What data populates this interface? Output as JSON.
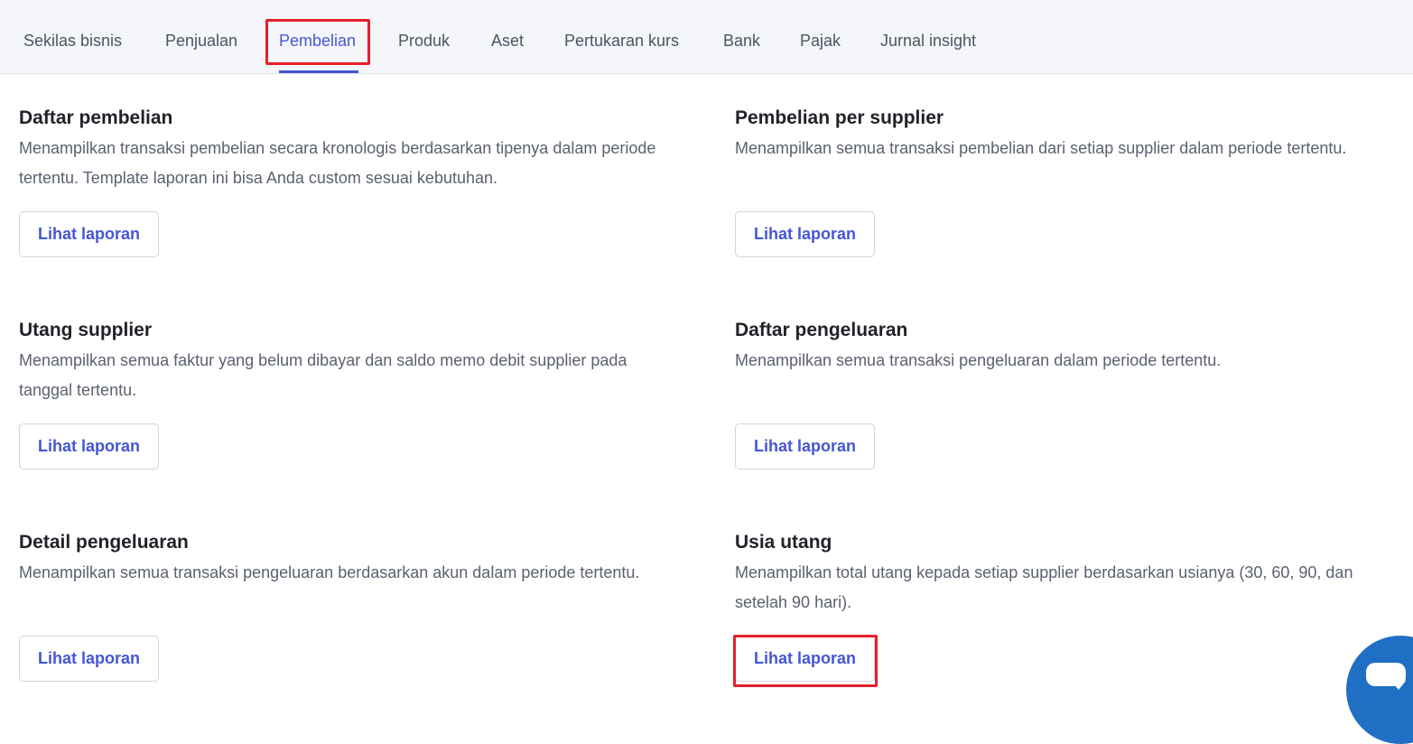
{
  "tabs": [
    {
      "label": "Sekilas bisnis",
      "active": false
    },
    {
      "label": "Penjualan",
      "active": false
    },
    {
      "label": "Pembelian",
      "active": true
    },
    {
      "label": "Produk",
      "active": false
    },
    {
      "label": "Aset",
      "active": false
    },
    {
      "label": "Pertukaran kurs",
      "active": false
    },
    {
      "label": "Bank",
      "active": false
    },
    {
      "label": "Pajak",
      "active": false
    },
    {
      "label": "Jurnal insight",
      "active": false
    }
  ],
  "reports": [
    {
      "title": "Daftar pembelian",
      "description": "Menampilkan transaksi pembelian secara kronologis berdasarkan tipenya dalam periode tertentu. Template laporan ini bisa Anda custom sesuai kebutuhan.",
      "button": "Lihat laporan"
    },
    {
      "title": "Pembelian per supplier",
      "description": "Menampilkan semua transaksi pembelian dari setiap supplier dalam periode tertentu.",
      "button": "Lihat laporan"
    },
    {
      "title": "Utang supplier",
      "description": "Menampilkan semua faktur yang belum dibayar dan saldo memo debit supplier pada tanggal tertentu.",
      "button": "Lihat laporan"
    },
    {
      "title": "Daftar pengeluaran",
      "description": "Menampilkan semua transaksi pengeluaran dalam periode tertentu.",
      "button": "Lihat laporan"
    },
    {
      "title": "Detail pengeluaran",
      "description": "Menampilkan semua transaksi pengeluaran berdasarkan akun dalam periode tertentu.",
      "button": "Lihat laporan"
    },
    {
      "title": "Usia utang",
      "description": "Menampilkan total utang kepada setiap supplier berdasarkan usianya (30, 60, 90, dan setelah 90 hari).",
      "button": "Lihat laporan"
    }
  ],
  "colors": {
    "accent": "#4556d4",
    "highlight": "#e5202b",
    "chat_fab": "#1f6fc5"
  },
  "icons": {
    "chat": "chat-bubble-icon"
  }
}
